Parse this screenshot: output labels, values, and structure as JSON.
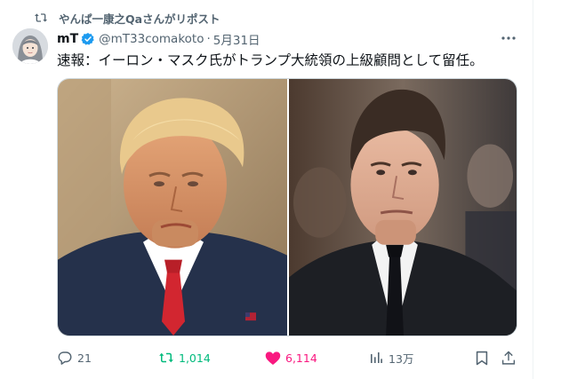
{
  "repost": {
    "icon": "repost-icon",
    "label": "やんぱ一康之Qaさんがリポスト"
  },
  "author": {
    "display_name": "mT",
    "handle": "@mT33comakoto",
    "separator": "·",
    "date": "5月31日",
    "verified": true
  },
  "tweet": {
    "text": "速報：イーロン・マスク氏がトランプ大統領の上級顧問として留任。"
  },
  "media": {
    "images": [
      "portrait-left",
      "portrait-right"
    ]
  },
  "actions": {
    "reply_count": "21",
    "repost_count": "1,014",
    "like_count": "6,114",
    "view_count": "13万"
  },
  "colors": {
    "text": "#0f1419",
    "muted": "#536471",
    "verified": "#1d9bf0",
    "repost": "#00ba7c",
    "like": "#f91880",
    "border": "#cfd9de"
  }
}
